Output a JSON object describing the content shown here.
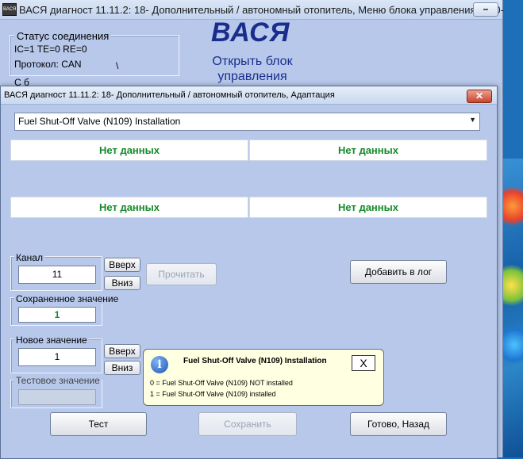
{
  "main_window": {
    "app_icon_text": "ВАСЯ",
    "title": "ВАСЯ диагност 11.11.2: 18- Дополнительный / автономный отопитель,  Меню блока управления (1K0-",
    "minimize_label": "–",
    "status_group_label": "Статус соединения",
    "status_line1": "IC=1  TE=0   RE=0",
    "status_line2": "Протокол: CAN",
    "status_extra": "\\",
    "logo": "ВАСЯ",
    "open_block_label": "Открыть блок управления",
    "partial_text": "С         б"
  },
  "dialog": {
    "title": "ВАСЯ диагност 11.11.2: 18- Дополнительный / автономный отопитель, Адаптация",
    "close_label": "✕",
    "selected_channel": "Fuel Shut-Off Valve (N109) Installation",
    "select_arrow": "▼",
    "data_fields": [
      "Нет данных",
      "Нет данных",
      "Нет данных",
      "Нет данных"
    ],
    "channel_label": "Канал",
    "channel_value": "11",
    "up_label": "Вверх",
    "down_label": "Вниз",
    "read_label": "Прочитать",
    "add_log_label": "Добавить в лог",
    "saved_label": "Сохраненное значение",
    "saved_value": "1",
    "new_label": "Новое значение",
    "new_value": "1",
    "up2_label": "Вверх",
    "down2_label": "Вниз",
    "test_value_label": "Тестовое значение",
    "test_value": "",
    "test_button": "Тест",
    "save_button": "Сохранить",
    "done_button": "Готово, Назад"
  },
  "tooltip": {
    "icon": "i",
    "title": "Fuel Shut-Off Valve (N109) Installation",
    "close_label": "X",
    "line1": "0 = Fuel Shut-Off Valve (N109) NOT installed",
    "line2": "1 = Fuel Shut-Off Valve (N109) installed"
  }
}
